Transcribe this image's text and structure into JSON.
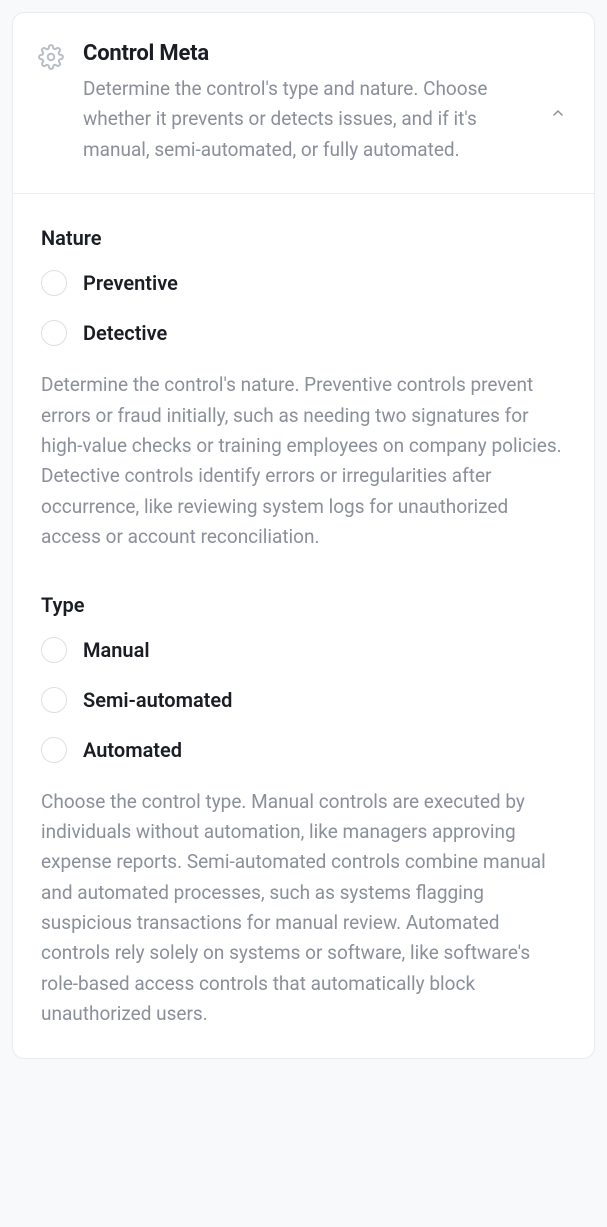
{
  "header": {
    "title": "Control Meta",
    "description": "Determine the control's type and nature. Choose whether it prevents or detects issues, and if it's manual, semi-automated, or fully automated."
  },
  "sections": {
    "nature": {
      "label": "Nature",
      "options": [
        {
          "label": "Preventive"
        },
        {
          "label": "Detective"
        }
      ],
      "description": "Determine the control's nature. Preventive controls prevent errors or fraud initially, such as needing two signatures for high-value checks or training employees on company policies. Detective controls identify errors or irregularities after occurrence, like reviewing system logs for unauthorized access or account reconciliation."
    },
    "type": {
      "label": "Type",
      "options": [
        {
          "label": "Manual"
        },
        {
          "label": "Semi-automated"
        },
        {
          "label": "Automated"
        }
      ],
      "description": "Choose the control type. Manual controls are executed by individuals without automation, like managers approving expense reports. Semi-automated controls combine manual and automated processes, such as systems flagging suspicious transactions for manual review. Automated controls rely solely on systems or software, like software's role-based access controls that automatically block unauthorized users."
    }
  }
}
